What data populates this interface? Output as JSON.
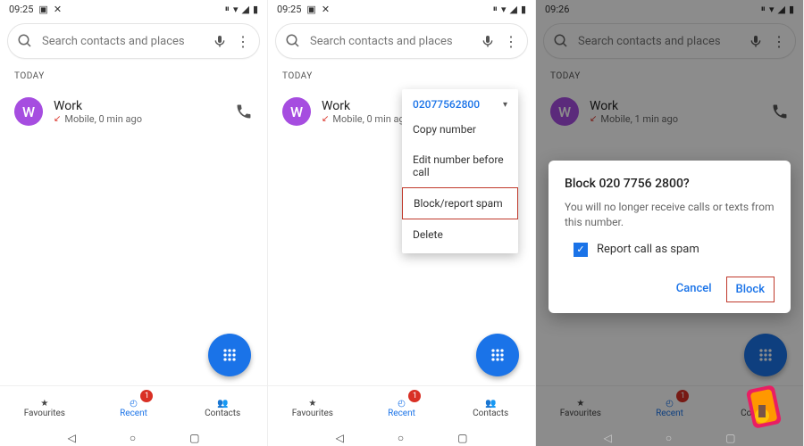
{
  "screens": [
    {
      "status": {
        "time": "09:25"
      },
      "search": {
        "placeholder": "Search contacts and places"
      },
      "section": "TODAY",
      "call": {
        "avatar_letter": "W",
        "name": "Work",
        "sub": "Mobile, 0 min ago"
      },
      "nav": {
        "favourites": "Favourites",
        "recent": "Recent",
        "contacts": "Contacts",
        "badge": "1"
      }
    },
    {
      "status": {
        "time": "09:25"
      },
      "search": {
        "placeholder": "Search contacts and places"
      },
      "section": "TODAY",
      "call": {
        "avatar_letter": "W",
        "name": "Work",
        "sub": "Mobile, 0 min ago"
      },
      "menu": {
        "number": "02077562800",
        "items": {
          "copy": "Copy number",
          "edit": "Edit number before call",
          "block": "Block/report spam",
          "delete": "Delete"
        }
      },
      "nav": {
        "favourites": "Favourites",
        "recent": "Recent",
        "contacts": "Contacts",
        "badge": "1"
      }
    },
    {
      "status": {
        "time": "09:26"
      },
      "search": {
        "placeholder": "Search contacts and places"
      },
      "section": "TODAY",
      "call": {
        "avatar_letter": "W",
        "name": "Work",
        "sub": "Mobile, 1 min ago"
      },
      "dialog": {
        "title": "Block 020 7756 2800?",
        "body": "You will no longer receive calls or texts from this number.",
        "check_label": "Report call as spam",
        "cancel": "Cancel",
        "block": "Block"
      },
      "nav": {
        "favourites": "Favourites",
        "recent": "Recent",
        "contacts": "Contacts",
        "badge": "1"
      }
    }
  ]
}
